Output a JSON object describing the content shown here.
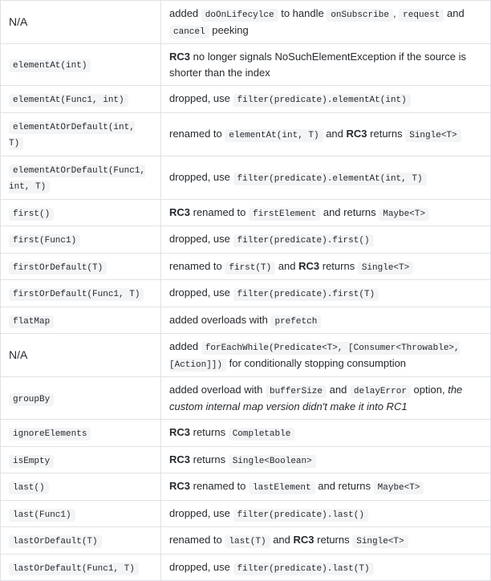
{
  "rows": [
    {
      "left_na": true,
      "left_text": "N/A",
      "right_parts": [
        {
          "t": "text",
          "v": "added "
        },
        {
          "t": "code",
          "v": "doOnLifecylce"
        },
        {
          "t": "text",
          "v": " to handle "
        },
        {
          "t": "code",
          "v": "onSubscribe"
        },
        {
          "t": "text",
          "v": ", "
        },
        {
          "t": "code",
          "v": "request"
        },
        {
          "t": "text",
          "v": " and "
        },
        {
          "t": "code",
          "v": "cancel"
        },
        {
          "t": "text",
          "v": " peeking"
        }
      ]
    },
    {
      "left_code": "elementAt(int)",
      "right_parts": [
        {
          "t": "bold",
          "v": "RC3"
        },
        {
          "t": "text",
          "v": " no longer signals NoSuchElementException if the source is shorter than the index"
        }
      ]
    },
    {
      "left_code": "elementAt(Func1, int)",
      "right_parts": [
        {
          "t": "text",
          "v": "dropped, use "
        },
        {
          "t": "code",
          "v": "filter(predicate).elementAt(int)"
        }
      ]
    },
    {
      "left_code": "elementAtOrDefault(int, T)",
      "right_parts": [
        {
          "t": "text",
          "v": "renamed to "
        },
        {
          "t": "code",
          "v": "elementAt(int, T)"
        },
        {
          "t": "text",
          "v": " and "
        },
        {
          "t": "bold",
          "v": "RC3"
        },
        {
          "t": "text",
          "v": " returns "
        },
        {
          "t": "code",
          "v": "Single<T>"
        }
      ]
    },
    {
      "left_code": "elementAtOrDefault(Func1, int, T)",
      "right_parts": [
        {
          "t": "text",
          "v": "dropped, use "
        },
        {
          "t": "code",
          "v": "filter(predicate).elementAt(int, T)"
        }
      ]
    },
    {
      "left_code": "first()",
      "right_parts": [
        {
          "t": "bold",
          "v": "RC3"
        },
        {
          "t": "text",
          "v": " renamed to "
        },
        {
          "t": "code",
          "v": "firstElement"
        },
        {
          "t": "text",
          "v": " and returns "
        },
        {
          "t": "code",
          "v": "Maybe<T>"
        }
      ]
    },
    {
      "left_code": "first(Func1)",
      "right_parts": [
        {
          "t": "text",
          "v": "dropped, use "
        },
        {
          "t": "code",
          "v": "filter(predicate).first()"
        }
      ]
    },
    {
      "left_code": "firstOrDefault(T)",
      "right_parts": [
        {
          "t": "text",
          "v": "renamed to "
        },
        {
          "t": "code",
          "v": "first(T)"
        },
        {
          "t": "text",
          "v": " and "
        },
        {
          "t": "bold",
          "v": "RC3"
        },
        {
          "t": "text",
          "v": " returns "
        },
        {
          "t": "code",
          "v": "Single<T>"
        }
      ]
    },
    {
      "left_code": "firstOrDefault(Func1, T)",
      "right_parts": [
        {
          "t": "text",
          "v": "dropped, use "
        },
        {
          "t": "code",
          "v": "filter(predicate).first(T)"
        }
      ]
    },
    {
      "left_code": "flatMap",
      "right_parts": [
        {
          "t": "text",
          "v": "added overloads with "
        },
        {
          "t": "code",
          "v": "prefetch"
        }
      ]
    },
    {
      "left_na": true,
      "left_text": "N/A",
      "right_parts": [
        {
          "t": "text",
          "v": "added "
        },
        {
          "t": "code",
          "v": "forEachWhile(Predicate<T>, [Consumer<Throwable>, [Action]])"
        },
        {
          "t": "text",
          "v": " for conditionally stopping consumption"
        }
      ]
    },
    {
      "left_code": "groupBy",
      "right_parts": [
        {
          "t": "text",
          "v": "added overload with "
        },
        {
          "t": "code",
          "v": "bufferSize"
        },
        {
          "t": "text",
          "v": " and "
        },
        {
          "t": "code",
          "v": "delayError"
        },
        {
          "t": "text",
          "v": " option, "
        },
        {
          "t": "italic",
          "v": "the custom internal map version didn't make it into RC1"
        }
      ]
    },
    {
      "left_code": "ignoreElements",
      "right_parts": [
        {
          "t": "bold",
          "v": "RC3"
        },
        {
          "t": "text",
          "v": " returns "
        },
        {
          "t": "code",
          "v": "Completable"
        }
      ]
    },
    {
      "left_code": "isEmpty",
      "right_parts": [
        {
          "t": "bold",
          "v": "RC3"
        },
        {
          "t": "text",
          "v": " returns "
        },
        {
          "t": "code",
          "v": "Single<Boolean>"
        }
      ]
    },
    {
      "left_code": "last()",
      "right_parts": [
        {
          "t": "bold",
          "v": "RC3"
        },
        {
          "t": "text",
          "v": " renamed to "
        },
        {
          "t": "code",
          "v": "lastElement"
        },
        {
          "t": "text",
          "v": " and returns "
        },
        {
          "t": "code",
          "v": "Maybe<T>"
        }
      ]
    },
    {
      "left_code": "last(Func1)",
      "right_parts": [
        {
          "t": "text",
          "v": "dropped, use "
        },
        {
          "t": "code",
          "v": "filter(predicate).last()"
        }
      ]
    },
    {
      "left_code": "lastOrDefault(T)",
      "right_parts": [
        {
          "t": "text",
          "v": "renamed to "
        },
        {
          "t": "code",
          "v": "last(T)"
        },
        {
          "t": "text",
          "v": " and "
        },
        {
          "t": "bold",
          "v": "RC3"
        },
        {
          "t": "text",
          "v": " returns "
        },
        {
          "t": "code",
          "v": "Single<T>"
        }
      ]
    },
    {
      "left_code": "lastOrDefault(Func1, T)",
      "right_parts": [
        {
          "t": "text",
          "v": "dropped, use "
        },
        {
          "t": "code",
          "v": "filter(predicate).last(T)"
        }
      ]
    }
  ]
}
